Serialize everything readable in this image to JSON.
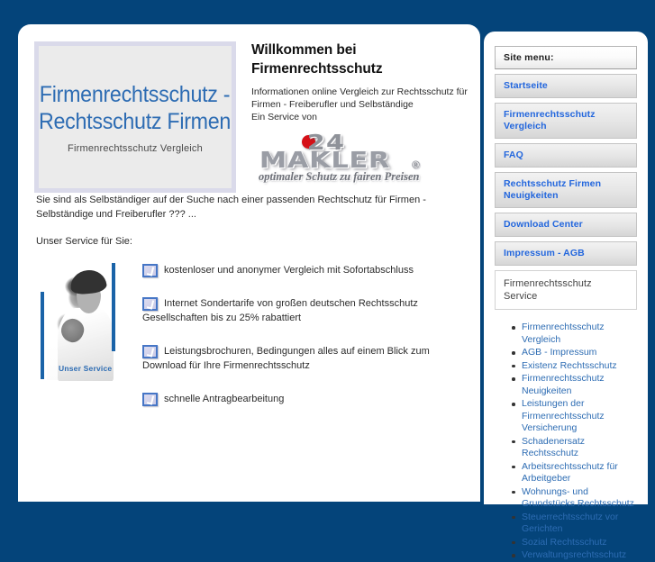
{
  "site": {
    "title_line1": "Firmenrechtsschutz -",
    "title_line2": "Rechtsschutz Firmen",
    "subtitle": "Firmenrechtsschutz Vergleich"
  },
  "header": {
    "welcome_line1": "Willkommen bei",
    "welcome_line2": "Firmenrechtsschutz",
    "description": "Informationen online Vergleich zur Rechtsschutz für Firmen - Freiberufler und Selbständige",
    "service_by": "Ein Service von"
  },
  "logo": {
    "top_text": "24",
    "main_text": "MAKLER",
    "registered": "®",
    "tagline": "optimaler Schutz  zu fairen Preisen"
  },
  "content": {
    "intro": "Sie sind als Selbständiger auf der Suche nach einer passenden Rechtschutz für Firmen - Selbständige und Freiberufler ??? ...",
    "service_lead": "Unser Service für Sie:",
    "photo_caption": "Unser Service",
    "services": [
      "kostenloser und anonymer Vergleich mit Sofortabschluss",
      "Internet Sondertarife von großen deutschen Rechtsschutz Gesellschaften bis zu 25% rabattiert",
      "Leistungsbrochuren,  Bedingungen alles auf einem Blick zum Download für Ihre Firmenrechtsschutz",
      "schnelle Antragbearbeitung"
    ]
  },
  "sidebar": {
    "menu_heading": "Site menu:",
    "menu_items": [
      {
        "label": "Startseite",
        "style": "link"
      },
      {
        "label": "Firmenrechtsschutz Vergleich",
        "style": "link"
      },
      {
        "label": "FAQ",
        "style": "link"
      },
      {
        "label": "Rechtsschutz Firmen Neuigkeiten",
        "style": "link"
      },
      {
        "label": "Download Center",
        "style": "link"
      },
      {
        "label": "Impressum - AGB",
        "style": "link"
      },
      {
        "label": "Firmenrechtsschutz Service",
        "style": "plain"
      }
    ],
    "links": [
      "Firmenrechtsschutz Vergleich",
      "AGB - Impressum",
      "Existenz Rechtsschutz",
      "Firmenrechtsschutz Neuigkeiten",
      "Leistungen der Firmenrechtsschutz Versicherung",
      "Schadenersatz Rechtsschutz",
      "Arbeitsrechtsschutz für Arbeitgeber",
      "Wohnungs- und Grundstücks Rechtsschutz",
      "Steuerrechtsschutz vor Gerichten",
      "Sozial Rechtsschutz",
      "Verwaltungsrechtsschutz"
    ]
  },
  "colors": {
    "page_background": "#04447a",
    "title_blue": "#2d6cb3",
    "link_blue": "#2266dd",
    "accent_bar": "#1a63a8",
    "logo_red": "#d51017"
  }
}
